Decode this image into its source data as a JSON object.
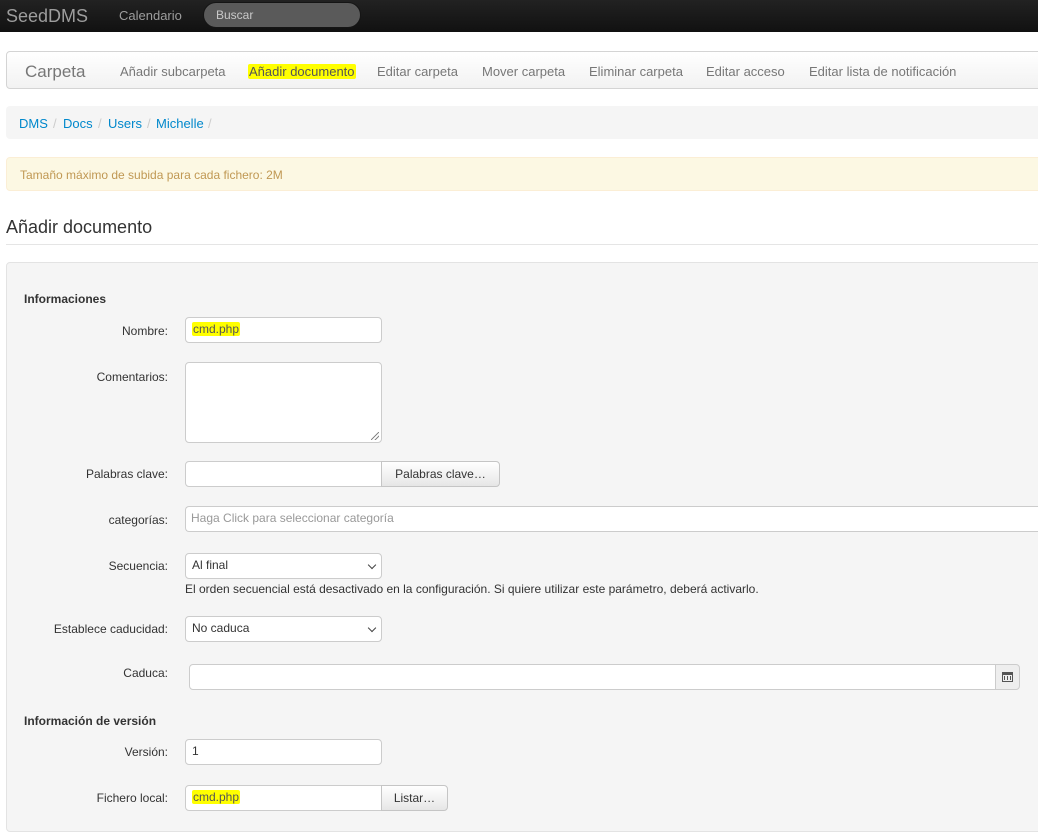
{
  "topbar": {
    "brand": "SeedDMS",
    "nav_calendar": "Calendario",
    "search_placeholder": "Buscar"
  },
  "folder_nav": {
    "brand": "Carpeta",
    "items": [
      "Añadir subcarpeta",
      "Añadir documento",
      "Editar carpeta",
      "Mover carpeta",
      "Eliminar carpeta",
      "Editar acceso",
      "Editar lista de notificación"
    ],
    "active": "Añadir documento"
  },
  "breadcrumb": [
    "DMS",
    "Docs",
    "Users",
    "Michelle"
  ],
  "alert": "Tamaño máximo de subida para cada fichero: 2M",
  "page_title": "Añadir documento",
  "form": {
    "section_info": "Informaciones",
    "name_label": "Nombre:",
    "name_value": "cmd.php",
    "comments_label": "Comentarios:",
    "comments_value": "",
    "keywords_label": "Palabras clave:",
    "keywords_button": "Palabras clave…",
    "categories_label": "categorías:",
    "categories_placeholder": "Haga Click para seleccionar categoría",
    "sequence_label": "Secuencia:",
    "sequence_value": "Al final",
    "sequence_help": "El orden secuencial está desactivado en la configuración. Si quiere utilizar este parámetro, deberá activarlo.",
    "expiration_set_label": "Establece caducidad:",
    "expiration_set_value": "No caduca",
    "expires_label": "Caduca:",
    "expires_value": "",
    "section_version": "Información de versión",
    "version_label": "Versión:",
    "version_value": "1",
    "local_file_label": "Fichero local:",
    "local_file_value": "cmd.php",
    "browse_button": "Listar…"
  },
  "colors": {
    "highlight": "#ffff00",
    "link": "#0088cc",
    "topbar": "#1b1b1b",
    "alert_text": "#c09853"
  }
}
